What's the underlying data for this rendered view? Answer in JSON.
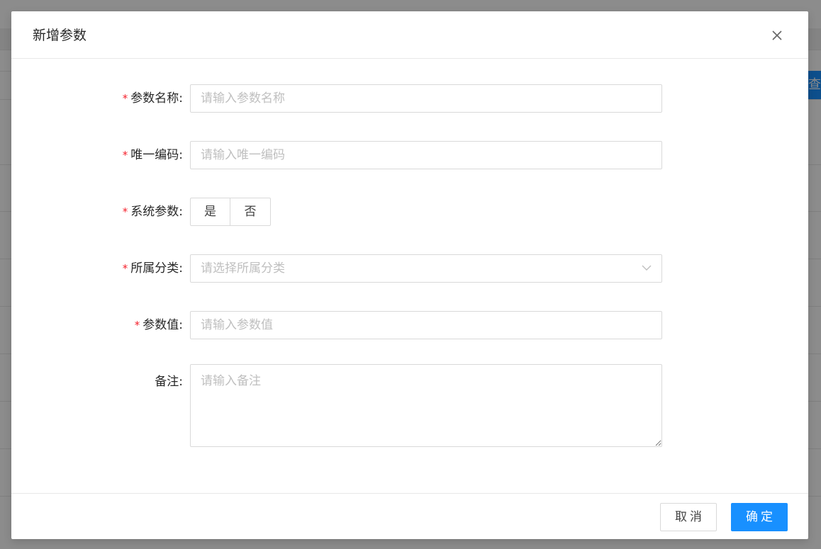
{
  "background": {
    "query_button_label": "查"
  },
  "modal": {
    "title": "新增参数",
    "fields": {
      "param_name": {
        "label": "参数名称",
        "suffix": ":",
        "required": true,
        "placeholder": "请输入参数名称"
      },
      "unique_code": {
        "label": "唯一编码",
        "suffix": ":",
        "required": true,
        "placeholder": "请输入唯一编码"
      },
      "system_param": {
        "label": "系统参数",
        "suffix": ":",
        "required": true,
        "options": [
          "是",
          "否"
        ]
      },
      "category": {
        "label": "所属分类",
        "suffix": ":",
        "required": true,
        "placeholder": "请选择所属分类"
      },
      "param_value": {
        "label": "参数值",
        "suffix": ":",
        "required": true,
        "placeholder": "请输入参数值"
      },
      "remark": {
        "label": "备注",
        "suffix": ":",
        "required": false,
        "placeholder": "请输入备注"
      }
    },
    "required_mark": "*",
    "footer": {
      "cancel_label": "取消",
      "ok_label": "确定"
    }
  },
  "colors": {
    "primary": "#1890ff",
    "required": "#f5222d",
    "border": "#d9d9d9",
    "placeholder": "#bfbfbf"
  },
  "icons": {
    "close": "close-icon",
    "select_arrow": "chevron-down-icon"
  }
}
